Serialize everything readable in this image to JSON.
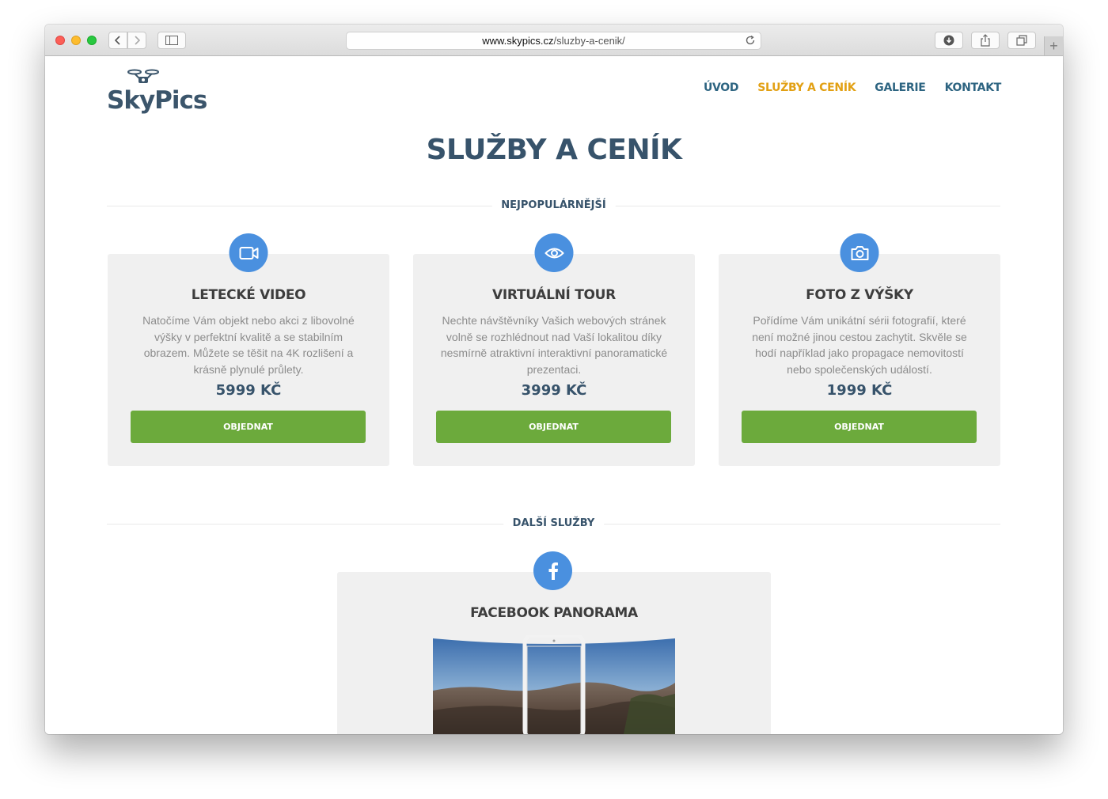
{
  "browser": {
    "url_domain": "www.skypics.cz",
    "url_path": "/sluzby-a-cenik/"
  },
  "site": {
    "logo_text": "SkyPics",
    "nav": [
      {
        "label": "ÚVOD",
        "active": false
      },
      {
        "label": "SLUŽBY A CENÍK",
        "active": true
      },
      {
        "label": "GALERIE",
        "active": false
      },
      {
        "label": "KONTAKT",
        "active": false
      }
    ],
    "nav_active_color": "#e2a013",
    "nav_color": "#2d6481"
  },
  "page": {
    "title": "SLUŽBY A CENÍK",
    "popular_heading": "NEJPOPULÁRNĚJŠÍ",
    "other_heading": "DALŠÍ SLUŽBY"
  },
  "services": [
    {
      "icon": "video-camera-icon",
      "title": "LETECKÉ VIDEO",
      "description": "Natočíme Vám objekt nebo akci z libovolné výšky v perfektní kvalitě a se stabilním obrazem. Můžete se těšit na 4K rozlišení a krásně plynulé průlety.",
      "price": "5999 KČ",
      "button": "OBJEDNAT"
    },
    {
      "icon": "eye-icon",
      "title": "VIRTUÁLNÍ TOUR",
      "description": "Nechte návštěvníky Vašich webových stránek volně se rozhlédnout nad Vaší lokalitou díky nesmírně atraktivní interaktivní panoramatické prezentaci.",
      "price": "3999 KČ",
      "button": "OBJEDNAT"
    },
    {
      "icon": "camera-icon",
      "title": "FOTO Z VÝŠKY",
      "description": "Pořídíme Vám unikátní sérii fotografií, které není možné jinou cestou zachytit. Skvěle se hodí například jako propagace nemovitostí nebo společenských událostí.",
      "price": "1999 KČ",
      "button": "OBJEDNAT"
    }
  ],
  "other_service": {
    "icon": "facebook-icon",
    "title": "FACEBOOK PANORAMA"
  },
  "colors": {
    "accent_blue": "#4a90df",
    "button_green": "#6caa3c",
    "heading_navy": "#37536b"
  }
}
